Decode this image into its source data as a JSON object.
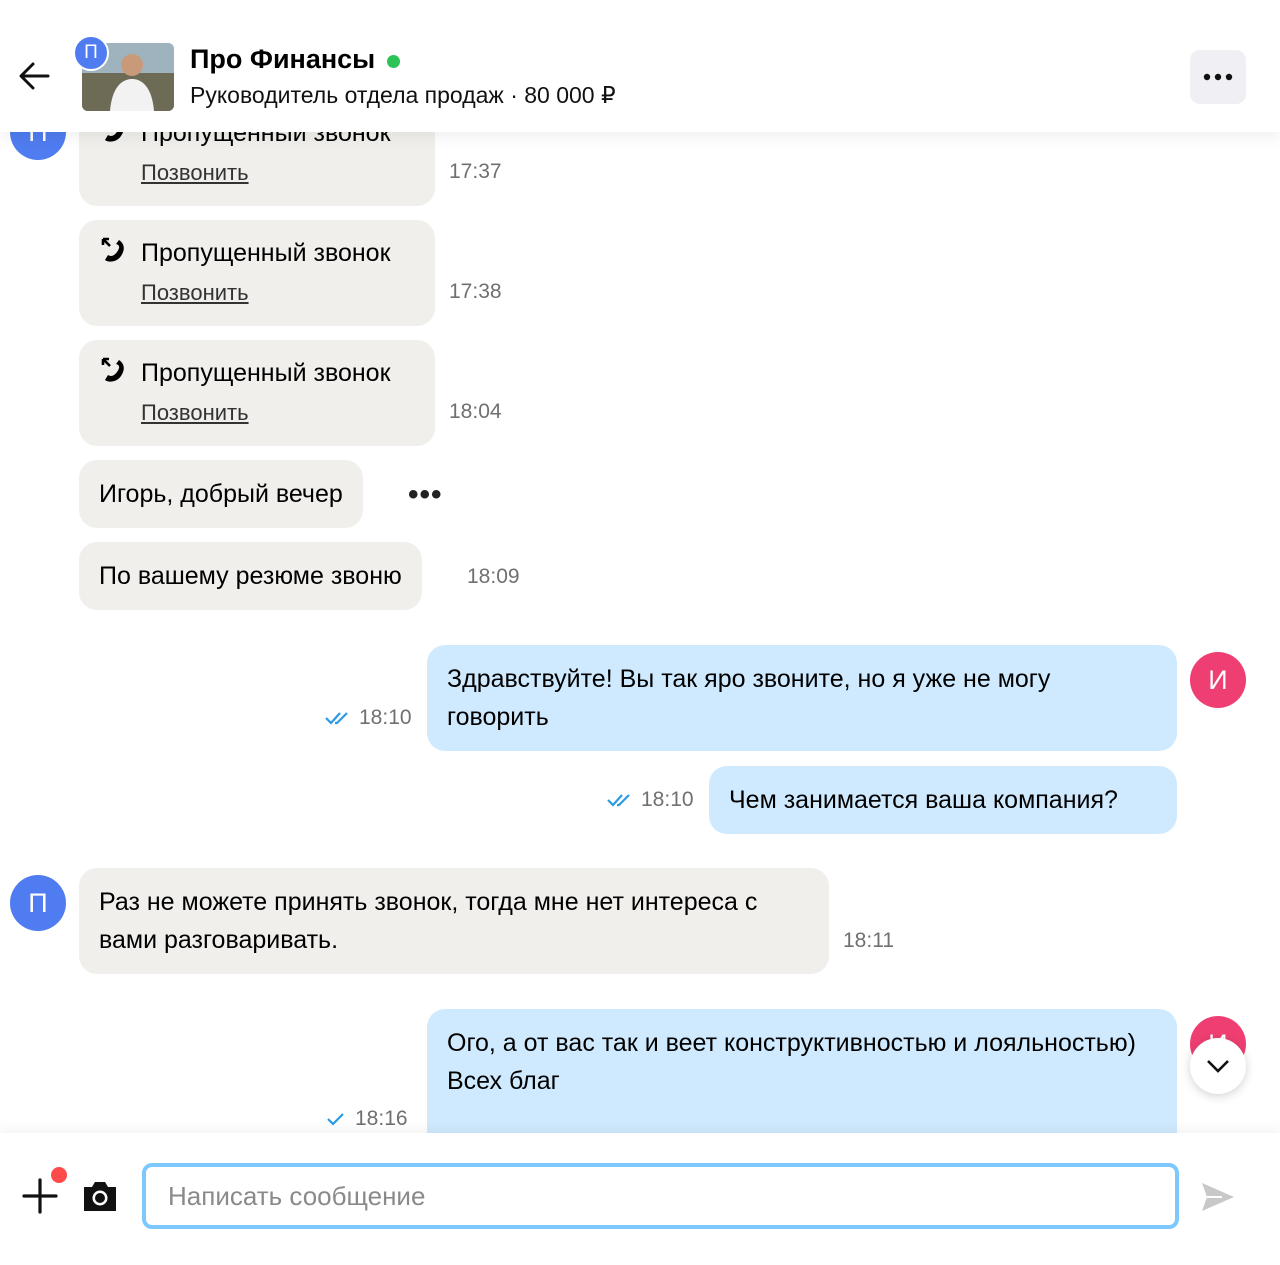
{
  "header": {
    "avatar_letter": "П",
    "title": "Про Финансы",
    "subtitle": "Руководитель отдела продаж · 80 000 ₽",
    "online_color": "#2bc358"
  },
  "icons": {
    "back": "arrow-left-icon",
    "more": "more-horizontal-icon",
    "missed_call": "missed-call-icon",
    "read": "double-check-icon",
    "sent": "check-icon",
    "scroll_down": "chevron-down-icon",
    "attach": "plus-icon",
    "camera": "camera-icon",
    "send": "send-icon"
  },
  "messages": {
    "call1": {
      "title": "Пропущенный звонок",
      "link": "Позвонить",
      "time": "17:37"
    },
    "call2": {
      "title": "Пропущенный звонок",
      "link": "Позвонить",
      "time": "17:38"
    },
    "call3": {
      "title": "Пропущенный звонок",
      "link": "Позвонить",
      "time": "18:04"
    },
    "in1": {
      "text": "Игорь, добрый вечер"
    },
    "in2": {
      "text": "По вашему резюме звоню",
      "time": "18:09"
    },
    "out1": {
      "text": "Здравствуйте! Вы так яро звоните, но я уже не могу говорить",
      "time": "18:10",
      "status": "read"
    },
    "out2": {
      "text": "Чем занимается ваша компания?",
      "time": "18:10",
      "status": "read"
    },
    "in3": {
      "text": "Раз не можете принять звонок, тогда мне нет интереса с вами разговаривать.",
      "time": "18:11"
    },
    "out3": {
      "line1": "Ого, а от вас так и веет конструктивностью и лояльностью)",
      "line2": "Всех благ",
      "time": "18:16",
      "status": "sent"
    }
  },
  "avatars": {
    "sender": "П",
    "me": "И"
  },
  "composer": {
    "placeholder": "Написать сообщение"
  },
  "colors": {
    "accent": "#4f7cf0",
    "me_avatar": "#ef3f72",
    "incoming_bubble": "#f0efeb",
    "outgoing_bubble": "#cfeaff",
    "read_check": "#2c9be6",
    "input_border": "#7cc8ff"
  }
}
